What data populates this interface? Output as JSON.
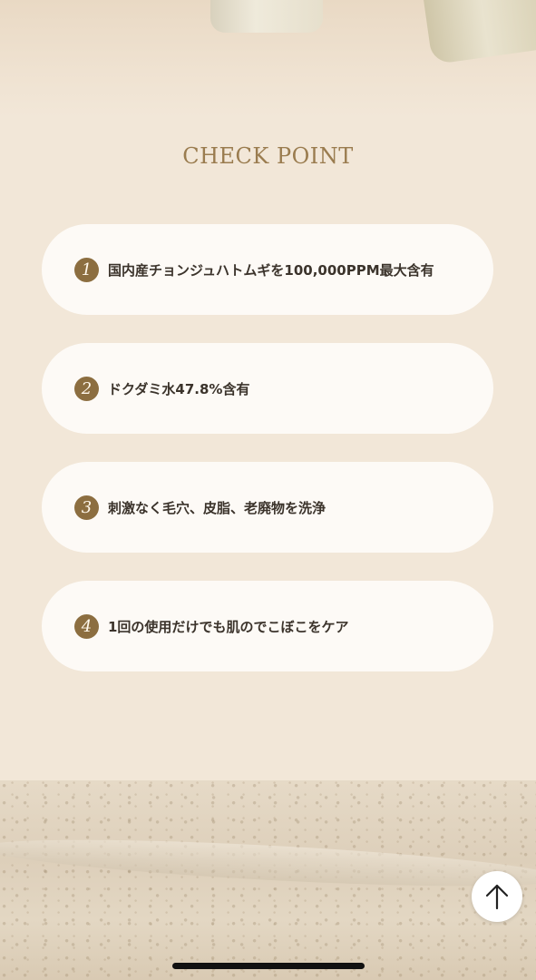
{
  "section": {
    "title": "CHECK POINT"
  },
  "check_points": [
    {
      "number": "1",
      "text": "国内産チョンジュハトムギを100,000PPM最大含有"
    },
    {
      "number": "2",
      "text": "ドクダミ水47.8%含有"
    },
    {
      "number": "3",
      "text": "刺激なく毛穴、皮脂、老廃物を洗浄"
    },
    {
      "number": "4",
      "text": "1回の使用だけでも肌のでこぼこをケア"
    }
  ],
  "colors": {
    "background": "#f2e7d8",
    "accent": "#9a7c4f",
    "badge": "#8c6e40",
    "card": "#fdfaf6"
  },
  "icons": {
    "scroll_top": "arrow-up-icon"
  }
}
